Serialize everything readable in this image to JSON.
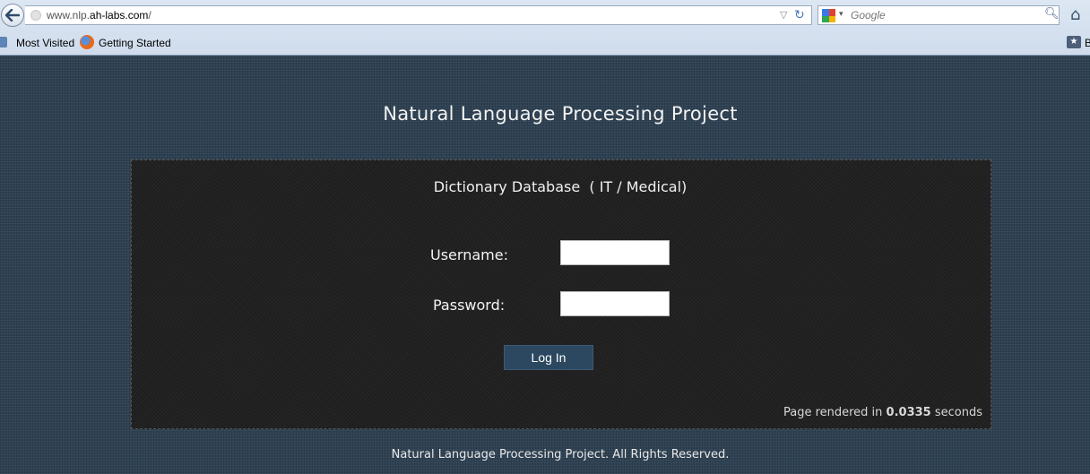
{
  "browser": {
    "url_prefix": "www.nlp.",
    "url_domain": "ah-labs.com",
    "url_suffix": "/",
    "search_placeholder": "Google",
    "bookmarks": {
      "most_visited": "Most Visited",
      "getting_started": "Getting Started",
      "right_truncated": "B"
    }
  },
  "page": {
    "title": "Natural Language Processing Project",
    "panel_title": "Dictionary Database  ( IT / Medical)",
    "username_label": "Username:",
    "password_label": "Password:",
    "username_value": "",
    "password_value": "",
    "login_button": "Log In",
    "render_prefix": "Page rendered in ",
    "render_time": "0.0335",
    "render_suffix": " seconds",
    "footer": "Natural Language Processing Project. All Rights Reserved."
  },
  "colors": {
    "page_background": "#2e4152",
    "panel_background": "#1e1e1e",
    "button_background": "#2c4860"
  },
  "icons": [
    "back-arrow-icon",
    "globe-icon",
    "dropdown-arrow-icon",
    "reload-icon",
    "google-logo-icon",
    "magnifier-icon",
    "home-icon",
    "bookmark-folder-icon",
    "firefox-icon",
    "bookmarks-star-icon"
  ]
}
